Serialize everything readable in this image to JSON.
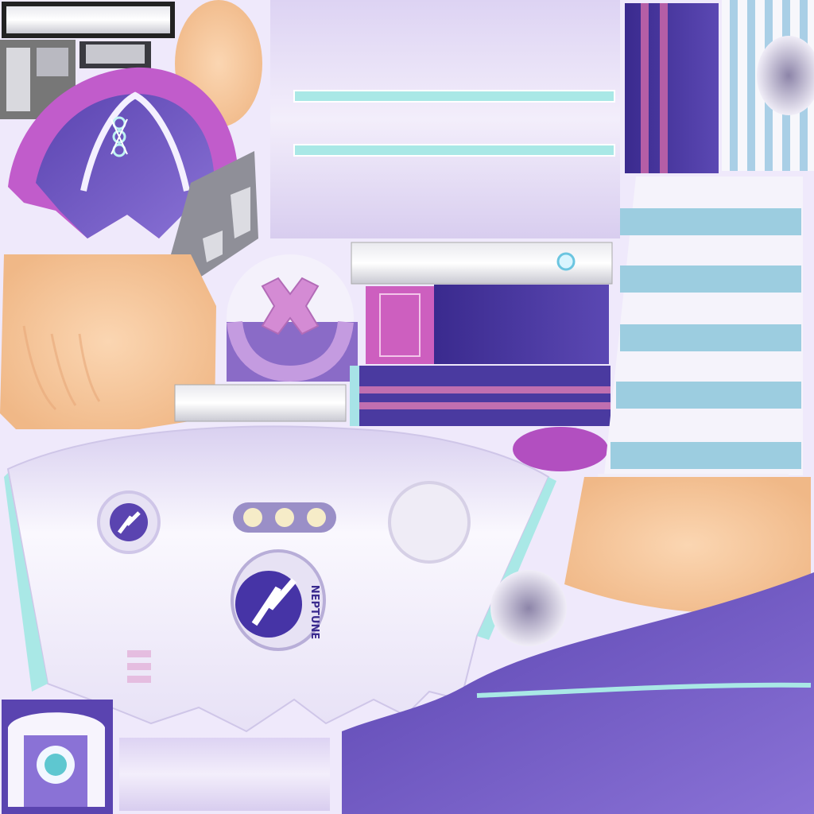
{
  "atlas": {
    "background": "#efe9fb",
    "palette": {
      "lavender_cloth": "#e6def7",
      "white_cloth": "#f8f6fd",
      "purple_cloth": "#6a55bf",
      "deep_purple": "#3e2f96",
      "magenta": "#b24fc0",
      "pink": "#d681c7",
      "cyan_stripe": "#a7e3e7",
      "light_blue_stripe": "#9ccde0",
      "skin": "#f6c79b",
      "metal": "#9a9aa3"
    },
    "emblem": {
      "text": "NEPTUNE"
    }
  }
}
